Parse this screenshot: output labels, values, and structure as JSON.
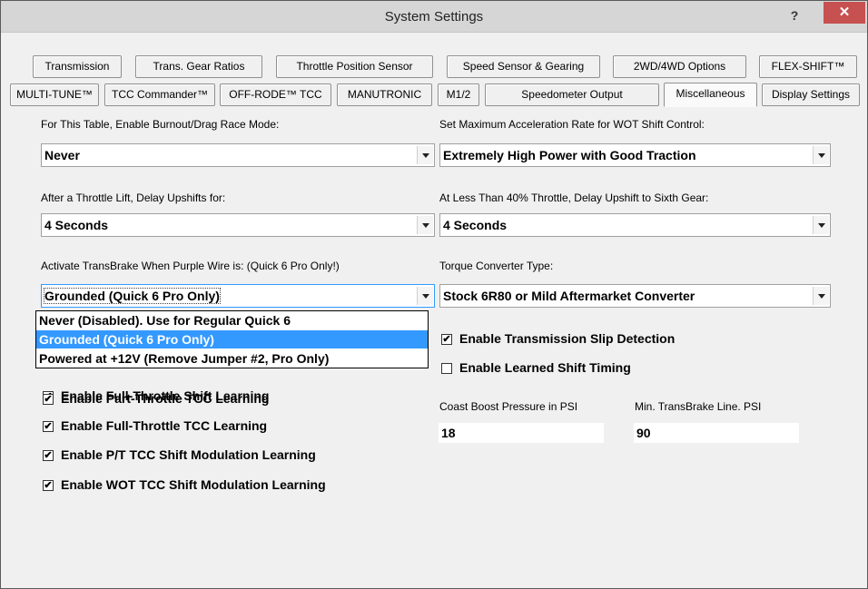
{
  "window": {
    "title": "System Settings",
    "help_label": "?",
    "close_label": "✕"
  },
  "tabs_row1": [
    "Transmission",
    "Trans. Gear Ratios",
    "Throttle Position Sensor",
    "Speed Sensor & Gearing",
    "2WD/4WD Options",
    "FLEX-SHIFT™"
  ],
  "tabs_row2": [
    "MULTI-TUNE™",
    "TCC Commander™",
    "OFF-RODE™ TCC",
    "MANUTRONIC",
    "M1/2",
    "Speedometer Output",
    "Miscellaneous",
    "Display Settings"
  ],
  "active_tab": "Miscellaneous",
  "fields": {
    "burnout": {
      "label": "For This Table, Enable Burnout/Drag Race Mode:",
      "value": "Never"
    },
    "accel": {
      "label": "Set Maximum Acceleration Rate for WOT Shift Control:",
      "value": "Extremely High Power with Good Traction"
    },
    "delay_upshift": {
      "label": "After a Throttle Lift, Delay Upshifts for:",
      "value": "4 Seconds"
    },
    "sixth_gear": {
      "label": "At Less Than 40% Throttle, Delay Upshift to Sixth Gear:",
      "value": "4 Seconds"
    },
    "transbrake": {
      "label": "Activate TransBrake When Purple Wire is: (Quick 6 Pro Only!)",
      "value": "Grounded (Quick 6 Pro Only)"
    },
    "converter": {
      "label": "Torque Converter Type:",
      "value": "Stock 6R80 or Mild Aftermarket Converter"
    }
  },
  "transbrake_options": [
    "Never (Disabled). Use for Regular Quick 6",
    "Grounded (Quick 6 Pro Only)",
    "Powered at +12V (Remove Jumper #2, Pro Only)"
  ],
  "transbrake_selected_index": 1,
  "checkboxes_left": [
    {
      "label": "Enable Full-Throttle Shift Learning",
      "checked": true
    },
    {
      "label": "Enable Part-Throttle TCC Learning",
      "checked": true
    },
    {
      "label": "Enable Full-Throttle TCC Learning",
      "checked": true
    },
    {
      "label": "Enable P/T TCC Shift Modulation Learning",
      "checked": true
    },
    {
      "label": "Enable WOT TCC Shift Modulation Learning",
      "checked": true
    }
  ],
  "checkboxes_right": [
    {
      "label": "Enable Transmission Slip Detection",
      "checked": true
    },
    {
      "label": "Enable Learned Shift Timing",
      "checked": false
    }
  ],
  "coast_boost": {
    "label": "Coast Boost Pressure in PSI",
    "value": "18"
  },
  "min_transbrake": {
    "label": "Min. TransBrake Line. PSI",
    "value": "90"
  },
  "check_glyph": "✔"
}
